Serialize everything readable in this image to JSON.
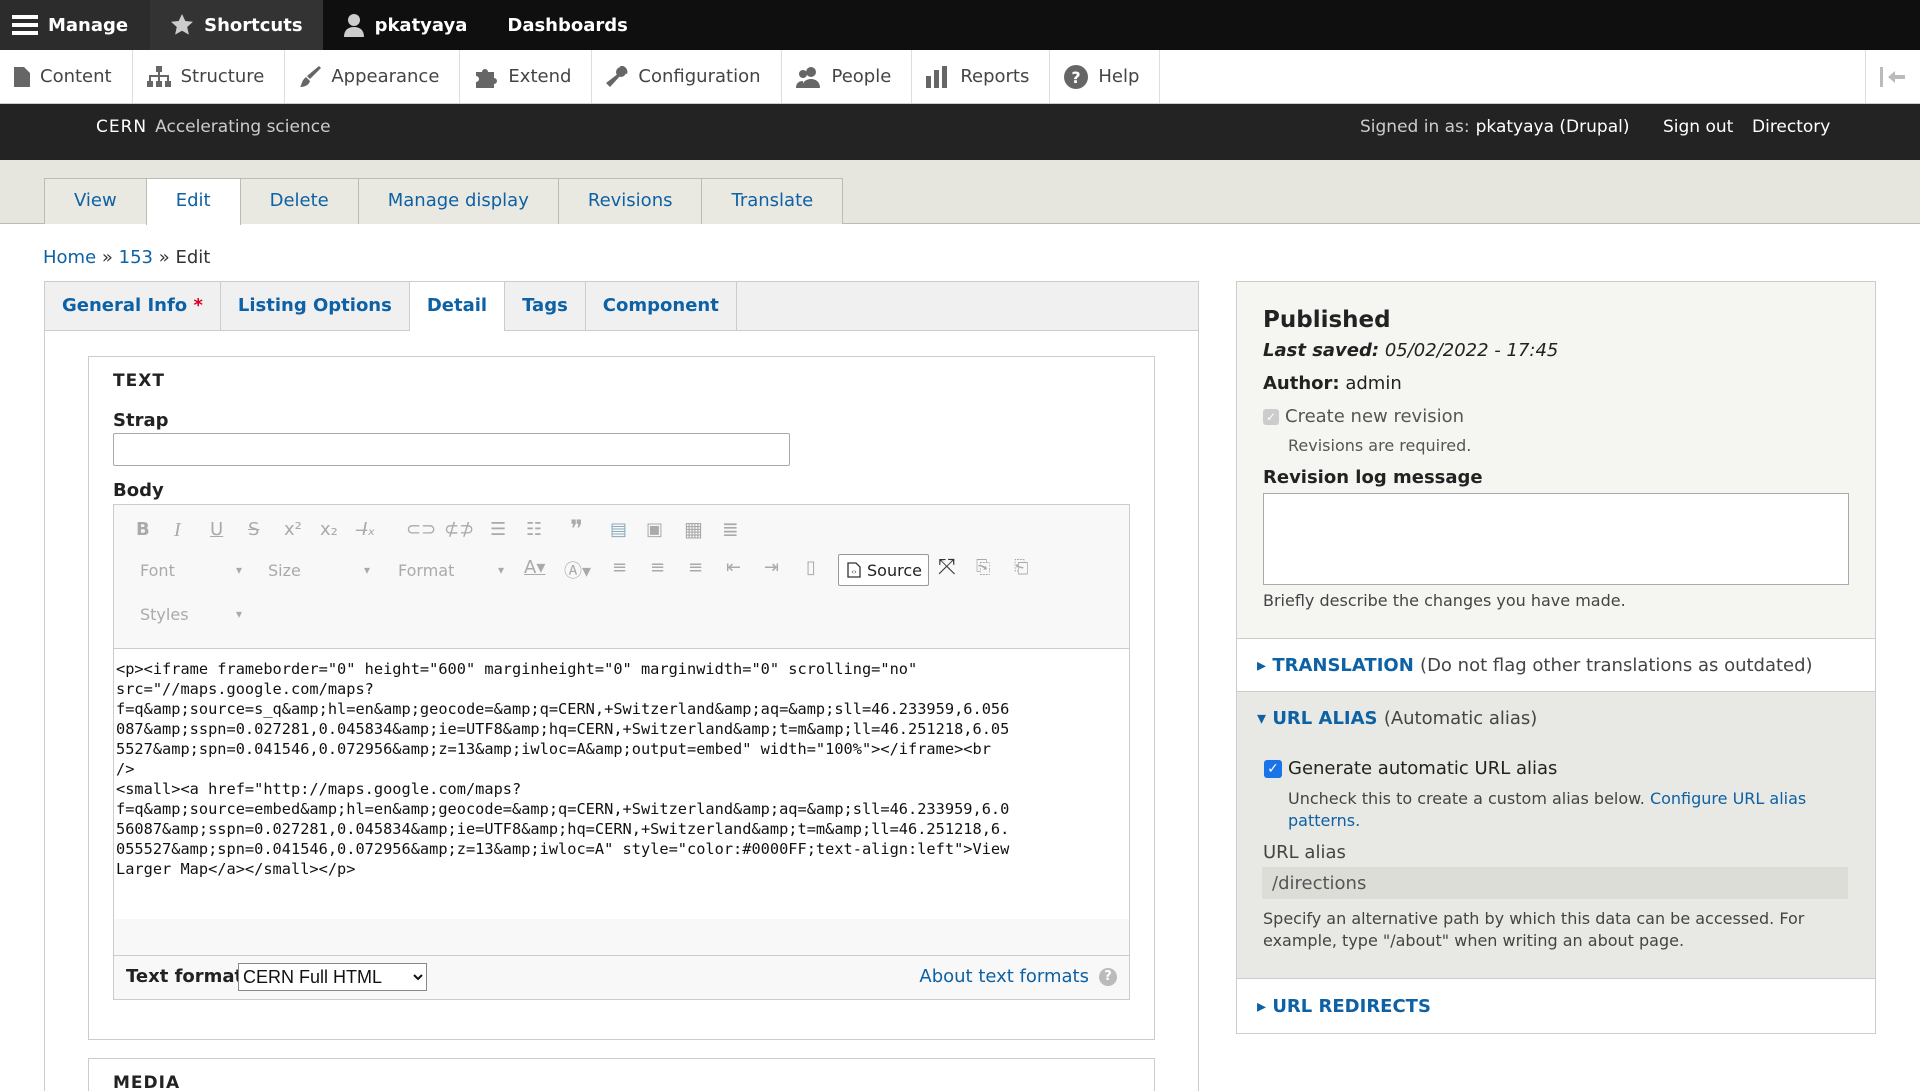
{
  "toolbar": {
    "manage": "Manage",
    "shortcuts": "Shortcuts",
    "user": "pkatyaya",
    "dashboards": "Dashboards"
  },
  "admin_menu": [
    {
      "label": "Content",
      "icon": "file-icon"
    },
    {
      "label": "Structure",
      "icon": "structure-icon"
    },
    {
      "label": "Appearance",
      "icon": "paintbrush-icon"
    },
    {
      "label": "Extend",
      "icon": "puzzle-icon"
    },
    {
      "label": "Configuration",
      "icon": "wrench-icon"
    },
    {
      "label": "People",
      "icon": "people-icon"
    },
    {
      "label": "Reports",
      "icon": "bar-chart-icon"
    },
    {
      "label": "Help",
      "icon": "help-icon"
    }
  ],
  "header": {
    "brand": "CERN",
    "tagline": "Accelerating science",
    "signed_in_label": "Signed in as:",
    "signed_in_user": "pkatyaya (Drupal)",
    "sign_out": "Sign out",
    "directory": "Directory"
  },
  "tabs": [
    "View",
    "Edit",
    "Delete",
    "Manage display",
    "Revisions",
    "Translate"
  ],
  "breadcrumb": {
    "home": "Home",
    "sep": "»",
    "node": "153",
    "current": "Edit"
  },
  "vertical_tabs": [
    "General Info",
    "Listing Options",
    "Detail",
    "Tags",
    "Component"
  ],
  "required_mark": "*",
  "text_section": {
    "legend": "TEXT",
    "strap_label": "Strap",
    "body_label": "Body",
    "toolbar_dropdowns": {
      "font": "Font",
      "size": "Size",
      "format": "Format",
      "styles": "Styles"
    },
    "source_button": "Source",
    "code_lines": [
      "<p><iframe frameborder=\"0\" height=\"600\" marginheight=\"0\" marginwidth=\"0\" scrolling=\"no\"",
      "src=\"//maps.google.com/maps?",
      "f=q&amp;source=s_q&amp;hl=en&amp;geocode=&amp;q=CERN,+Switzerland&amp;aq=&amp;sll=46.233959,6.056",
      "087&amp;sspn=0.027281,0.045834&amp;ie=UTF8&amp;hq=CERN,+Switzerland&amp;t=m&amp;ll=46.251218,6.05",
      "5527&amp;spn=0.041546,0.072956&amp;z=13&amp;iwloc=A&amp;output=embed\" width=\"100%\"></iframe><br",
      "/>",
      "<small><a href=\"http://maps.google.com/maps?",
      "f=q&amp;source=embed&amp;hl=en&amp;geocode=&amp;q=CERN,+Switzerland&amp;aq=&amp;sll=46.233959,6.0",
      "56087&amp;sspn=0.027281,0.045834&amp;ie=UTF8&amp;hq=CERN,+Switzerland&amp;t=m&amp;ll=46.251218,6.",
      "055527&amp;spn=0.041546,0.072956&amp;z=13&amp;iwloc=A\" style=\"color:#0000FF;text-align:left\">View",
      "Larger Map</a></small></p>"
    ],
    "text_format_label": "Text format",
    "text_format_value": "CERN Full HTML",
    "about_text_formats": "About text formats"
  },
  "media_legend": "MEDIA",
  "sidebar": {
    "status": "Published",
    "last_saved_label": "Last saved:",
    "last_saved_value": "05/02/2022 - 17:45",
    "author_label": "Author:",
    "author_value": "admin",
    "create_revision": "Create new revision",
    "revisions_required": "Revisions are required.",
    "revision_log_label": "Revision log message",
    "revision_log_help": "Briefly describe the changes you have made.",
    "translation_title": "TRANSLATION",
    "translation_note": "(Do not flag other translations as outdated)",
    "url_alias_title": "URL ALIAS",
    "url_alias_note": "(Automatic alias)",
    "generate_alias": "Generate automatic URL alias",
    "uncheck_help": "Uncheck this to create a custom alias below.",
    "configure_link": "Configure URL alias patterns.",
    "url_alias_label": "URL alias",
    "url_alias_value": "/directions",
    "alias_help": "Specify an alternative path by which this data can be accessed. For example, type \"/about\" when writing an about page.",
    "url_redirects_title": "URL REDIRECTS"
  }
}
